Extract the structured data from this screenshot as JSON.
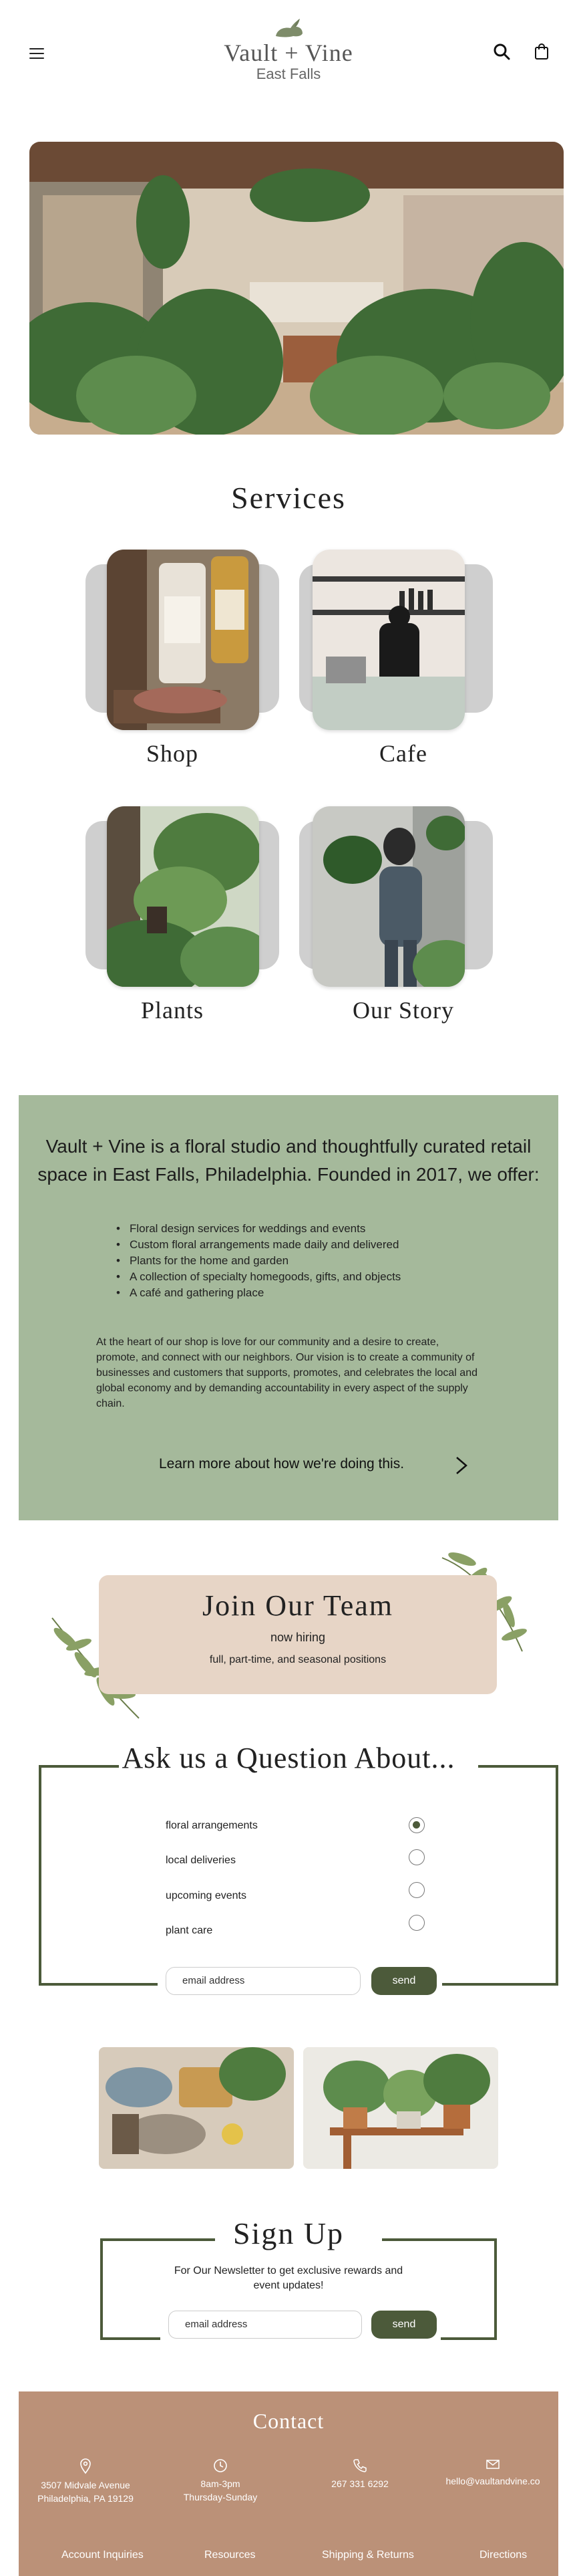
{
  "header": {
    "brand_name": "Vault + Vine",
    "brand_location": "East Falls",
    "icons": [
      "menu-icon",
      "search-icon",
      "shopping-bag-icon"
    ]
  },
  "services": {
    "title": "Services",
    "items": [
      {
        "label": "Shop"
      },
      {
        "label": "Cafe"
      },
      {
        "label": "Plants"
      },
      {
        "label": "Our Story"
      }
    ]
  },
  "about": {
    "headline": "Vault + Vine is a floral studio and thoughtfully curated retail space in East Falls, Philadelphia. Founded in 2017, we offer:",
    "offerings": [
      "Floral design services for weddings and events",
      "Custom floral arrangements made daily and delivered",
      "Plants for the home and garden",
      "A collection of specialty homegoods,  gifts, and objects",
      "A café and gathering place"
    ],
    "paragraph": "At the heart of our shop is love for our community and a desire to create, promote, and connect with our neighbors. Our vision is to create a community of businesses and customers that supports, promotes, and celebrates the local and global economy and by demanding accountability in every aspect of the supply chain.",
    "learn_more": "Learn more about how we're doing this."
  },
  "join": {
    "title": "Join Our Team",
    "hiring": "now hiring",
    "positions": "full, part-time, and seasonal positions"
  },
  "question": {
    "title": "Ask us a Question About...",
    "options": [
      {
        "label": "floral arrangements",
        "selected": true
      },
      {
        "label": "local deliveries",
        "selected": false
      },
      {
        "label": "upcoming events",
        "selected": false
      },
      {
        "label": "plant care",
        "selected": false
      }
    ],
    "email_placeholder": "email address",
    "send_label": "send"
  },
  "signup": {
    "title": "Sign Up",
    "text": "For Our Newsletter to get exclusive rewards and event updates!",
    "email_placeholder": "email address",
    "send_label": "send"
  },
  "contact": {
    "title": "Contact",
    "address_line1": "3507 Midvale Avenue",
    "address_line2": "Philadelphia, PA 19129",
    "hours_line1": "8am-3pm",
    "hours_line2": "Thursday-Sunday",
    "phone": "267 331 6292",
    "email": "hello@vaultandvine.co",
    "footer_links": [
      "Account Inquiries",
      "Resources",
      "Shipping & Returns",
      "Directions"
    ]
  },
  "colors": {
    "sage": "#a5b99b",
    "olive": "#4c5a3a",
    "blush": "#e7d5c6",
    "terracotta": "#bb9178"
  }
}
